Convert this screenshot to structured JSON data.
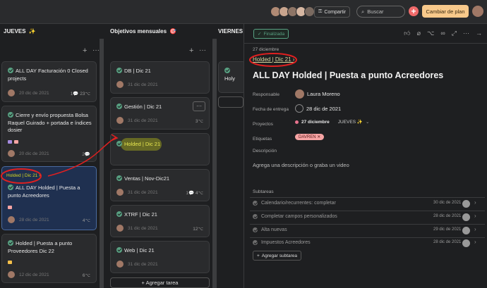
{
  "topbar": {
    "share_label": "Compartir",
    "search_placeholder": "Buscar",
    "upgrade_label": "Cambiar de plan"
  },
  "board": {
    "columns": [
      {
        "title": "JUEVES",
        "emoji": "✨"
      },
      {
        "title": "Objetivos mensuales",
        "emoji": "🎯"
      },
      {
        "title": "VIERNES",
        "emoji": ""
      }
    ],
    "jueves_cards": [
      {
        "title": "ALL DAY Facturación 0 Closed projects",
        "date": "20 dic de 2021",
        "meta": "1💬 23⌥"
      },
      {
        "title": "Cierre y envío propuesta Bolsa Raquel Guirado + portada e índices dosier",
        "date": "20 dic de 2021",
        "meta": "2💬"
      },
      {
        "parent": "Holded | Dic 21 ›",
        "title": "ALL DAY Holded | Puesta a punto Acreedores",
        "date": "28 dic de 2021",
        "meta": "4⌥"
      },
      {
        "title": "Holded | Puesta a punto Proveedores Dic 22",
        "date": "12 dic de 2021",
        "meta": "6⌥"
      }
    ],
    "objetivos_cards": [
      {
        "title": "DB | Dic 21",
        "date": "31 dic de 2021",
        "meta": ""
      },
      {
        "title": "Gestión | Dic 21",
        "date": "31 dic de 2021",
        "meta": "3⌥"
      },
      {
        "title": "Holded | Dic 21",
        "date": "",
        "meta": ""
      },
      {
        "title": "Ventas | Nov-Dic21",
        "date": "31 dic de 2021",
        "meta": "1💬 4⌥"
      },
      {
        "title": "XTRF | Dic 21",
        "date": "31 dic de 2021",
        "meta": "12⌥"
      },
      {
        "title": "Web | Dic 21",
        "date": "31 dic de 2021",
        "meta": ""
      }
    ],
    "viernes_card": "Holy",
    "add_task_label": "+ Agregar tarea"
  },
  "detail": {
    "status": "Finalizada",
    "date_line": "27 diciembre",
    "parent_link": "Holded | Dic 21 ›",
    "title": "ALL DAY Holded | Puesta a punto Acreedores",
    "fields": {
      "responsable_label": "Responsable",
      "responsable": "Laura Moreno",
      "fecha_label": "Fecha de entrega",
      "fecha": "28 dic de 2021",
      "proyectos_label": "Proyectos",
      "proyecto_fecha": "27 diciembre",
      "proyecto_sec": "JUEVES ✨",
      "etiquetas_label": "Etiquetas",
      "etiqueta": "DAVREN",
      "descripcion_label": "Descripción",
      "descripcion_placeholder": "Agrega una descripción o graba un video"
    },
    "subtareas_label": "Subtareas",
    "subtasks": [
      {
        "name": "Calendario/recurrentes: completar",
        "date": "30 dic de 2021"
      },
      {
        "name": "Completar campos personalizados",
        "date": "28 dic de 2021"
      },
      {
        "name": "Alta nuevas",
        "date": "29 dic de 2021"
      },
      {
        "name": "Impuestos Acreedores",
        "date": "28 dic de 2021"
      }
    ],
    "add_subtask_label": "Agregar subtarea"
  },
  "colors": {
    "accent_green": "#58a182",
    "annotation_red": "#e02020",
    "highlight_yellow": "#d8d820"
  }
}
